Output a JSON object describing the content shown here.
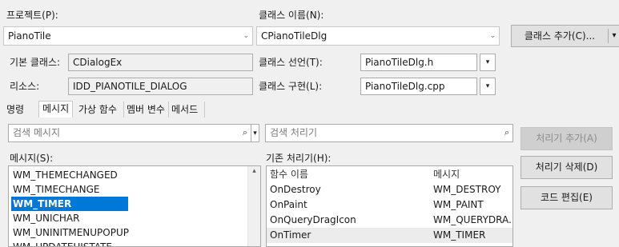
{
  "project": {
    "label": "프로젝트(P):",
    "value": "PianoTile"
  },
  "class": {
    "label": "클래스 이름(N):",
    "value": "CPianoTileDlg"
  },
  "add_class_button": {
    "label": "클래스 추가(C)...",
    "dropdown": "▾"
  },
  "base_class": {
    "label": "기본 클래스:",
    "value": "CDialogEx"
  },
  "resource": {
    "label": "리소스:",
    "value": "IDD_PIANOTILE_DIALOG"
  },
  "class_decl": {
    "label": "클래스 선언(T):",
    "value": "PianoTileDlg.h"
  },
  "class_impl": {
    "label": "클래스 구현(L):",
    "value": "PianoTileDlg.cpp"
  },
  "tabs": [
    {
      "label": "명령"
    },
    {
      "label": "메시지"
    },
    {
      "label": "가상 함수"
    },
    {
      "label": "멤버 변수"
    },
    {
      "label": "메서드"
    }
  ],
  "message_search": {
    "placeholder": "검색 메시지"
  },
  "handler_search": {
    "placeholder": "검색 처리기"
  },
  "messages": {
    "label": "메시지(S):",
    "items": [
      "WM_THEMECHANGED",
      "WM_TIMECHANGE",
      "WM_TIMER",
      "WM_UNICHAR",
      "WM_UNINITMENUPOPUP",
      "WM_UPDATEUISTATE"
    ],
    "selected_index": 2
  },
  "handlers": {
    "label": "기존 처리기(H):",
    "columns": [
      "함수 이름",
      "메시지"
    ],
    "rows": [
      [
        "OnDestroy",
        "WM_DESTROY"
      ],
      [
        "OnPaint",
        "WM_PAINT"
      ],
      [
        "OnQueryDragIcon",
        "WM_QUERYDRA..."
      ],
      [
        "OnTimer",
        "WM_TIMER"
      ]
    ],
    "highlighted_index": 3
  },
  "actions": {
    "add_handler": "처리기 추가(A)",
    "delete_handler": "처리기 삭제(D)",
    "edit_code": "코드 편집(E)"
  },
  "glyphs": {
    "chevron": "⌄",
    "search": "⌕",
    "dropdown_arrow": "▾",
    "scroll_up": "▴"
  },
  "colors": {
    "selection": "#0078d7",
    "window": "#f0f0f0"
  }
}
